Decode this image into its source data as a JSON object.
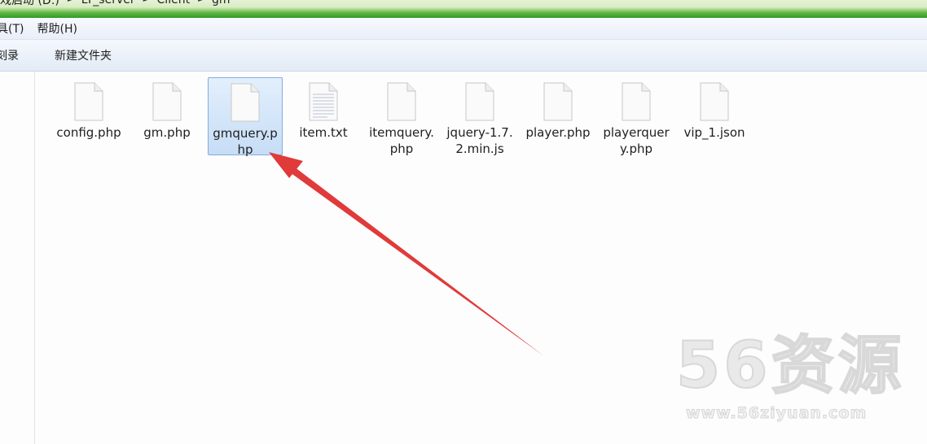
{
  "breadcrumbs": [
    "戏启动 (D:)",
    "LY_server",
    "Client",
    "gm"
  ],
  "menu": [
    "具(T)",
    "帮助(H)"
  ],
  "toolbar": {
    "burn_label": "刻录",
    "new_folder_label": "新建文件夹"
  },
  "files": [
    {
      "name": "config.php",
      "icon": "php-file-icon",
      "selected": false
    },
    {
      "name": "gm.php",
      "icon": "php-file-icon",
      "selected": false
    },
    {
      "name": "gmquery.php",
      "icon": "php-file-icon",
      "selected": true
    },
    {
      "name": "item.txt",
      "icon": "text-file-icon",
      "selected": false
    },
    {
      "name": "itemquery.php",
      "icon": "php-file-icon",
      "selected": false
    },
    {
      "name": "jquery-1.7.2.min.js",
      "icon": "js-file-icon",
      "selected": false
    },
    {
      "name": "player.php",
      "icon": "php-file-icon",
      "selected": false
    },
    {
      "name": "playerquery.php",
      "icon": "php-file-icon",
      "selected": false
    },
    {
      "name": "vip_1.json",
      "icon": "json-file-icon",
      "selected": false
    }
  ],
  "annotation": {
    "arrow_color": "#e03a3a"
  },
  "watermark": {
    "logo_text": "56资源",
    "url": "www.56ziyuan.com"
  },
  "colors": {
    "selection": "#cce2fa",
    "address_green": "#3aa232"
  }
}
